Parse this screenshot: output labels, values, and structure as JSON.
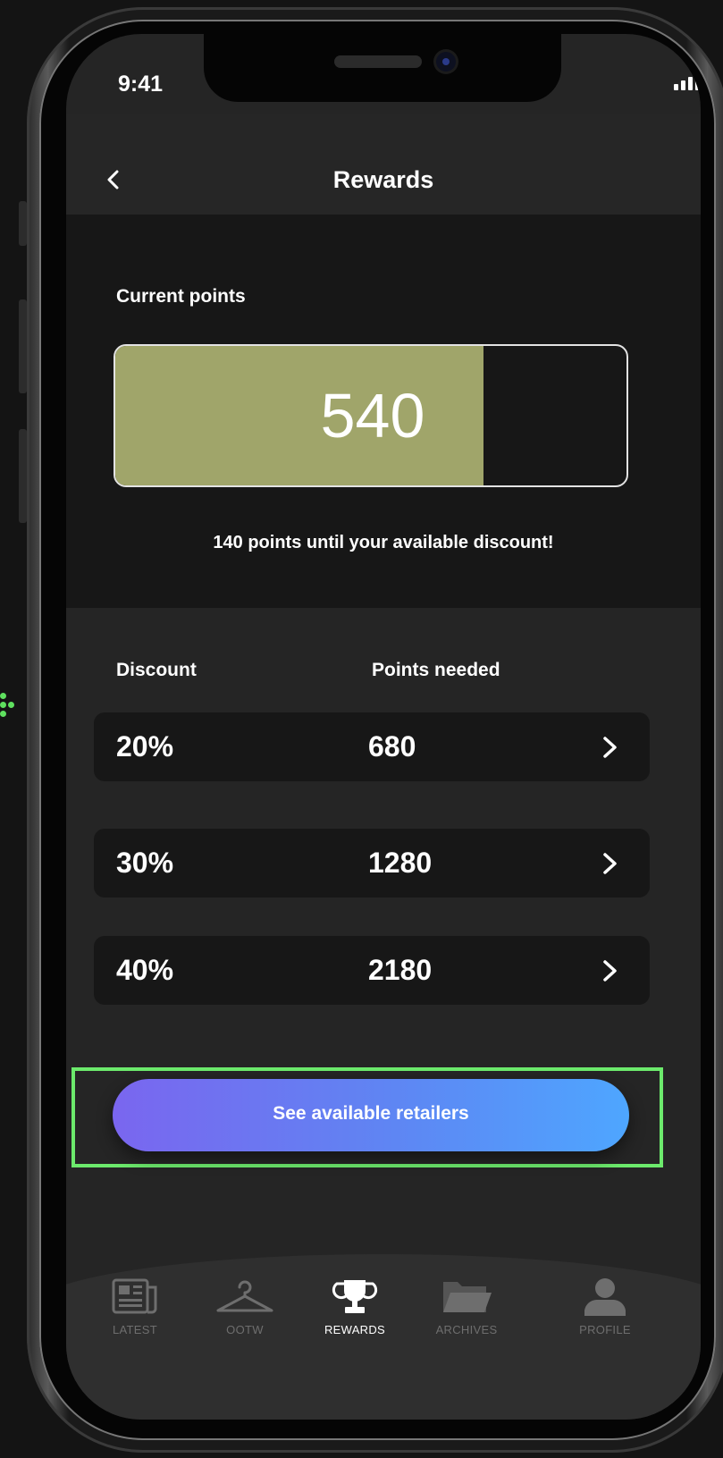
{
  "status_bar": {
    "time": "9:41"
  },
  "header": {
    "title": "Rewards"
  },
  "points": {
    "label": "Current points",
    "value": "540",
    "progress_fraction": 0.72,
    "until_text": "140 points until your available discount!"
  },
  "discounts": {
    "headers": {
      "discount": "Discount",
      "points_needed": "Points needed"
    },
    "rows": [
      {
        "discount": "20%",
        "points": "680"
      },
      {
        "discount": "30%",
        "points": "1280"
      },
      {
        "discount": "40%",
        "points": "2180"
      }
    ]
  },
  "cta": {
    "label": "See available retailers"
  },
  "tabs": [
    {
      "label": "LATEST",
      "icon": "newspaper-icon",
      "active": false
    },
    {
      "label": "OOTW",
      "icon": "hanger-icon",
      "active": false
    },
    {
      "label": "REWARDS",
      "icon": "trophy-icon",
      "active": true
    },
    {
      "label": "ARCHIVES",
      "icon": "folder-icon",
      "active": false
    },
    {
      "label": "PROFILE",
      "icon": "person-icon",
      "active": false
    }
  ],
  "colors": {
    "progress_fill": "#a0a56a",
    "cta_gradient_start": "#7a66ef",
    "cta_gradient_end": "#4ea6ff",
    "highlight_border": "#6cea6c"
  }
}
